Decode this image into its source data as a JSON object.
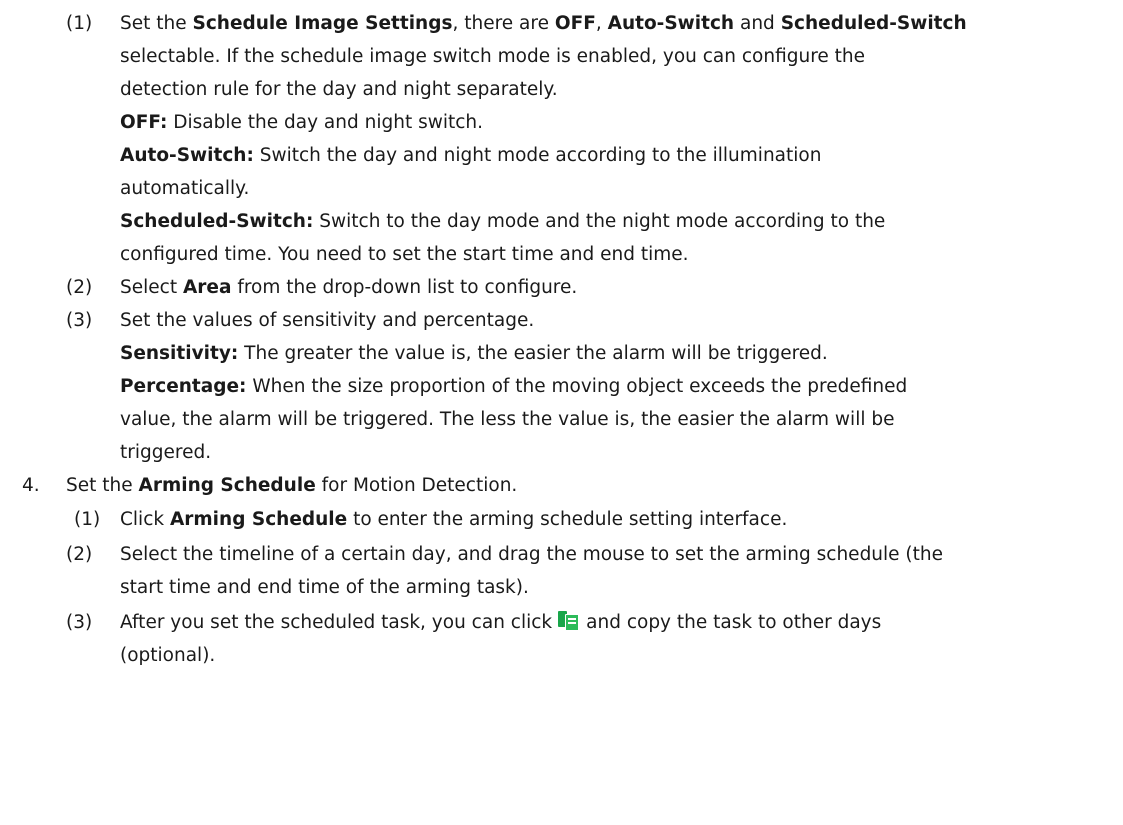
{
  "steps": {
    "s1": {
      "num": "(1)",
      "a": "Set the ",
      "b1": "Schedule Image Settings",
      "c": ", there are ",
      "b2": "OFF",
      "d": ", ",
      "b3": "Auto-Switch",
      "e": " and ",
      "b4": "Scheduled-Switch"
    },
    "s1_l2": "selectable. If the schedule image switch mode is enabled, you can configure the",
    "s1_l3": "detection rule for the day and night separately.",
    "off": {
      "label": "OFF:",
      "text": " Disable the day and night switch."
    },
    "auto": {
      "label": "Auto-Switch:",
      "text": " Switch the day and night mode according to the illumination"
    },
    "auto_l2": "automatically.",
    "sched": {
      "label": "Scheduled-Switch:",
      "text": " Switch to the day mode and the night mode according to the"
    },
    "sched_l2": "configured time. You need to set the start time and end time.",
    "s2": {
      "num": "(2)",
      "a": "Select ",
      "b": "Area",
      "c": " from the drop-down list to configure."
    },
    "s3": {
      "num": "(3)",
      "text": "Set the values of sensitivity and percentage."
    },
    "sens": {
      "label": "Sensitivity:",
      "text": " The greater the value is, the easier the alarm will be triggered."
    },
    "perc": {
      "label": "Percentage:",
      "text": " When the size proportion of the moving object exceeds the predefined"
    },
    "perc_l2": "value, the alarm will be triggered. The less the value is, the easier the alarm will be",
    "perc_l3": "triggered.",
    "s4": {
      "num": "4.",
      "a": "Set the ",
      "b": "Arming Schedule",
      "c": " for Motion Detection."
    },
    "s4_1": {
      "num": "(1)",
      "a": "Click ",
      "b": "Arming Schedule",
      "c": " to enter the arming schedule setting interface."
    },
    "s4_2": {
      "num": "(2)",
      "text": "Select the timeline of a certain day, and drag the mouse to set the arming schedule (the"
    },
    "s4_2_l2": "start time and end time of the arming task).",
    "s4_3": {
      "num": "(3)",
      "a": "After you set the scheduled task, you can click",
      "icon": "copy-icon",
      "b": "and copy the task to other days"
    },
    "s4_3_l2": "(optional)."
  }
}
